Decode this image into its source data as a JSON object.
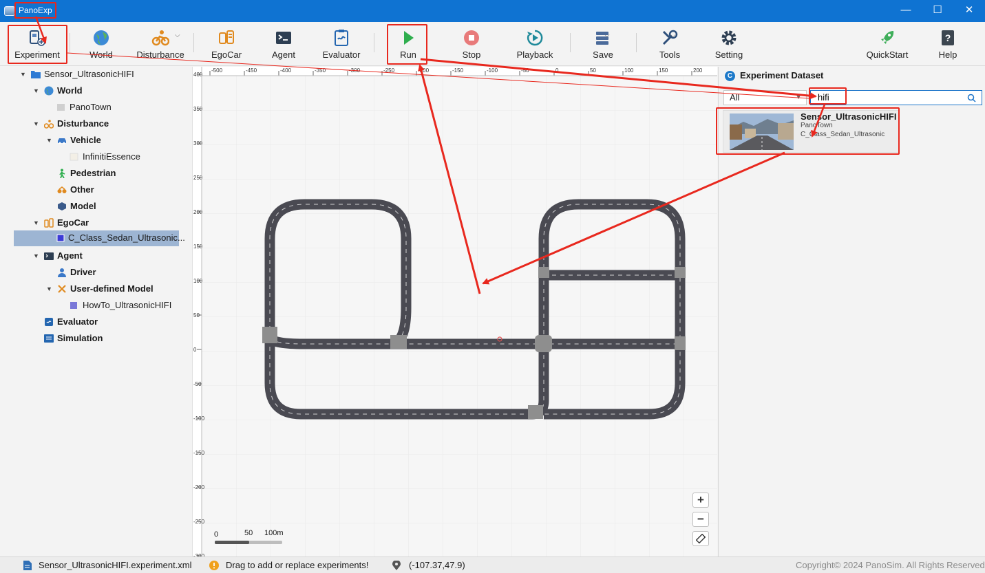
{
  "window": {
    "title": "PanoExp",
    "minimize": "—",
    "maximize": "☐",
    "close": "✕"
  },
  "toolbar": {
    "experiment": "Experiment",
    "world": "World",
    "disturbance": "Disturbance",
    "egocar": "EgoCar",
    "agent": "Agent",
    "evaluator": "Evaluator",
    "run": "Run",
    "stop": "Stop",
    "playback": "Playback",
    "save": "Save",
    "tools": "Tools",
    "setting": "Setting",
    "quickstart": "QuickStart",
    "help": "Help"
  },
  "tree": {
    "root": "Sensor_UltrasonicHIFI",
    "world": "World",
    "world_map": "PanoTown",
    "disturbance": "Disturbance",
    "vehicle": "Vehicle",
    "vehicle_item": "InfinitiEssence",
    "pedestrian": "Pedestrian",
    "other": "Other",
    "model": "Model",
    "egocar": "EgoCar",
    "egocar_item": "C_Class_Sedan_Ultrasonic...",
    "agent": "Agent",
    "driver": "Driver",
    "user_model": "User-defined Model",
    "user_model_item": "HowTo_UltrasonicHIFI",
    "evaluator": "Evaluator",
    "simulation": "Simulation"
  },
  "map": {
    "x_ticks": [
      "-500",
      "-450",
      "-400",
      "-350",
      "-300",
      "-250",
      "-200",
      "-150",
      "-100",
      "-50",
      "0",
      "50",
      "100",
      "150",
      "200"
    ],
    "y_ticks": [
      "400",
      "350",
      "300",
      "250",
      "200",
      "150",
      "100",
      "50",
      "0",
      "-50",
      "-100",
      "-150",
      "-200",
      "-250",
      "-300"
    ],
    "scale_labels": [
      "0",
      "50",
      "100m"
    ],
    "zoom_in": "+",
    "zoom_out": "−"
  },
  "dataset": {
    "title": "Experiment Dataset",
    "filter_value": "All",
    "search_value": "hifi",
    "card": {
      "name": "Sensor_UltrasonicHIFI",
      "map": "PanoTown",
      "car": "C_Class_Sedan_Ultrasonic"
    }
  },
  "status": {
    "file": "Sensor_UltrasonicHIFI.experiment.xml",
    "hint": "Drag to add or replace experiments!",
    "coords": "(-107.37,47.9)",
    "copyright": "Copyright© 2024 PanoSim. All Rights Reserved"
  },
  "colors": {
    "titlebar": "#0f73d2",
    "annotation": "#e8281e",
    "road": "#4a4a52",
    "run_green": "#2fae4e",
    "stop_red": "#e87a7a"
  }
}
